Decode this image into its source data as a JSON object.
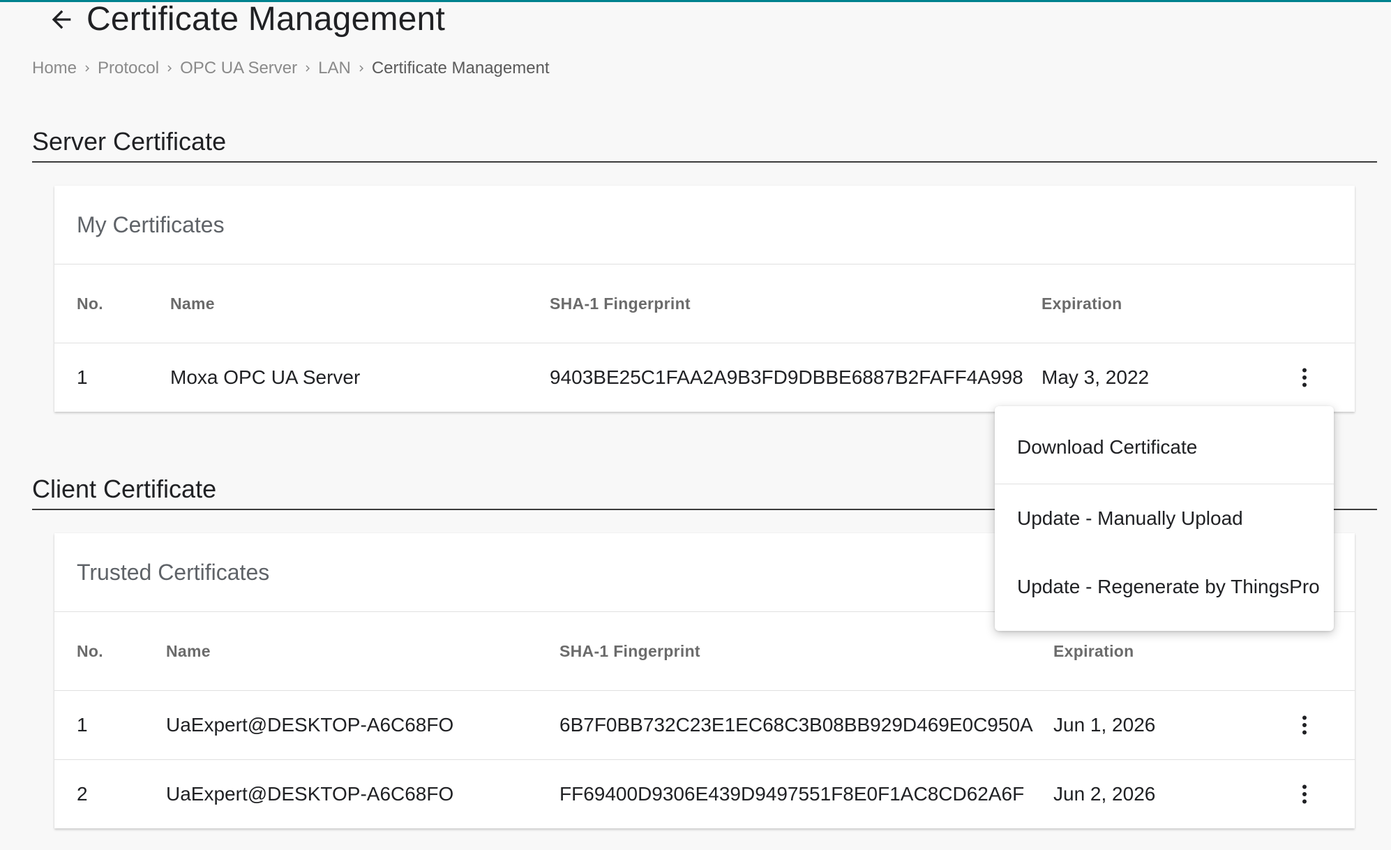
{
  "page": {
    "title": "Certificate Management",
    "accent_color": "#00838f"
  },
  "breadcrumb": [
    "Home",
    "Protocol",
    "OPC UA Server",
    "LAN",
    "Certificate Management"
  ],
  "server_section": {
    "title": "Server Certificate",
    "card_title": "My Certificates",
    "columns": [
      "No.",
      "Name",
      "SHA-1 Fingerprint",
      "Expiration"
    ],
    "rows": [
      {
        "no": "1",
        "name": "Moxa OPC UA Server",
        "fingerprint": "9403BE25C1FAA2A9B3FD9DBBE6887B2FAFF4A998",
        "expiration": "May 3, 2022"
      }
    ]
  },
  "client_section": {
    "title": "Client Certificate",
    "card_title": "Trusted Certificates",
    "columns": [
      "No.",
      "Name",
      "SHA-1 Fingerprint",
      "Expiration"
    ],
    "rows": [
      {
        "no": "1",
        "name": "UaExpert@DESKTOP-A6C68FO",
        "fingerprint": "6B7F0BB732C23E1EC68C3B08BB929D469E0C950A",
        "expiration": "Jun 1, 2026"
      },
      {
        "no": "2",
        "name": "UaExpert@DESKTOP-A6C68FO",
        "fingerprint": "FF69400D9306E439D9497551F8E0F1AC8CD62A6F",
        "expiration": "Jun 2, 2026"
      }
    ]
  },
  "context_menu": {
    "items": [
      "Download Certificate",
      "Update - Manually Upload",
      "Update - Regenerate by ThingsPro"
    ]
  },
  "icons": {
    "back": "arrow-left-icon",
    "separator": "chevron-right-icon",
    "more": "more-vertical-icon"
  }
}
